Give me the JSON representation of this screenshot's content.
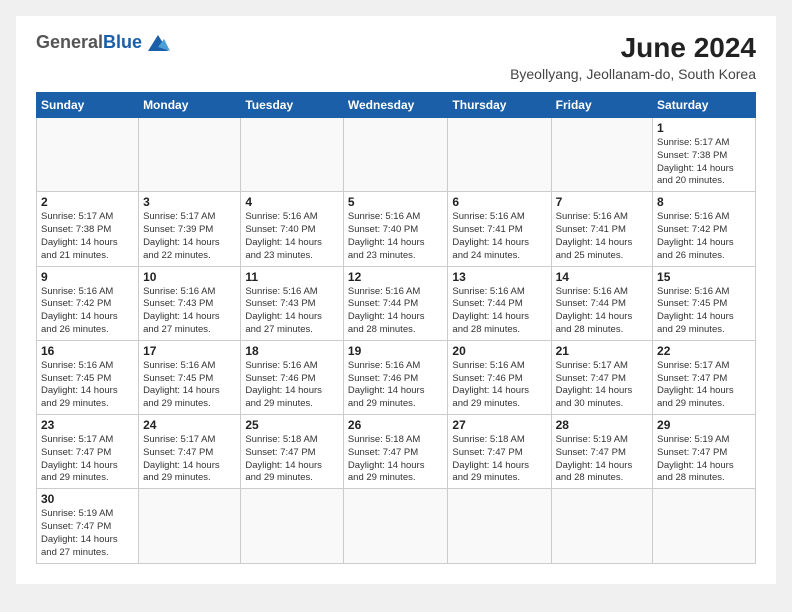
{
  "header": {
    "logo_general": "General",
    "logo_blue": "Blue",
    "month_year": "June 2024",
    "location": "Byeollyang, Jeollanam-do, South Korea"
  },
  "days_of_week": [
    "Sunday",
    "Monday",
    "Tuesday",
    "Wednesday",
    "Thursday",
    "Friday",
    "Saturday"
  ],
  "weeks": [
    [
      {
        "day": "",
        "info": ""
      },
      {
        "day": "",
        "info": ""
      },
      {
        "day": "",
        "info": ""
      },
      {
        "day": "",
        "info": ""
      },
      {
        "day": "",
        "info": ""
      },
      {
        "day": "",
        "info": ""
      },
      {
        "day": "1",
        "info": "Sunrise: 5:17 AM\nSunset: 7:38 PM\nDaylight: 14 hours\nand 20 minutes."
      }
    ],
    [
      {
        "day": "2",
        "info": "Sunrise: 5:17 AM\nSunset: 7:38 PM\nDaylight: 14 hours\nand 21 minutes."
      },
      {
        "day": "3",
        "info": "Sunrise: 5:17 AM\nSunset: 7:39 PM\nDaylight: 14 hours\nand 22 minutes."
      },
      {
        "day": "4",
        "info": "Sunrise: 5:16 AM\nSunset: 7:40 PM\nDaylight: 14 hours\nand 23 minutes."
      },
      {
        "day": "5",
        "info": "Sunrise: 5:16 AM\nSunset: 7:40 PM\nDaylight: 14 hours\nand 23 minutes."
      },
      {
        "day": "6",
        "info": "Sunrise: 5:16 AM\nSunset: 7:41 PM\nDaylight: 14 hours\nand 24 minutes."
      },
      {
        "day": "7",
        "info": "Sunrise: 5:16 AM\nSunset: 7:41 PM\nDaylight: 14 hours\nand 25 minutes."
      },
      {
        "day": "8",
        "info": "Sunrise: 5:16 AM\nSunset: 7:42 PM\nDaylight: 14 hours\nand 26 minutes."
      }
    ],
    [
      {
        "day": "9",
        "info": "Sunrise: 5:16 AM\nSunset: 7:42 PM\nDaylight: 14 hours\nand 26 minutes."
      },
      {
        "day": "10",
        "info": "Sunrise: 5:16 AM\nSunset: 7:43 PM\nDaylight: 14 hours\nand 27 minutes."
      },
      {
        "day": "11",
        "info": "Sunrise: 5:16 AM\nSunset: 7:43 PM\nDaylight: 14 hours\nand 27 minutes."
      },
      {
        "day": "12",
        "info": "Sunrise: 5:16 AM\nSunset: 7:44 PM\nDaylight: 14 hours\nand 28 minutes."
      },
      {
        "day": "13",
        "info": "Sunrise: 5:16 AM\nSunset: 7:44 PM\nDaylight: 14 hours\nand 28 minutes."
      },
      {
        "day": "14",
        "info": "Sunrise: 5:16 AM\nSunset: 7:44 PM\nDaylight: 14 hours\nand 28 minutes."
      },
      {
        "day": "15",
        "info": "Sunrise: 5:16 AM\nSunset: 7:45 PM\nDaylight: 14 hours\nand 29 minutes."
      }
    ],
    [
      {
        "day": "16",
        "info": "Sunrise: 5:16 AM\nSunset: 7:45 PM\nDaylight: 14 hours\nand 29 minutes."
      },
      {
        "day": "17",
        "info": "Sunrise: 5:16 AM\nSunset: 7:45 PM\nDaylight: 14 hours\nand 29 minutes."
      },
      {
        "day": "18",
        "info": "Sunrise: 5:16 AM\nSunset: 7:46 PM\nDaylight: 14 hours\nand 29 minutes."
      },
      {
        "day": "19",
        "info": "Sunrise: 5:16 AM\nSunset: 7:46 PM\nDaylight: 14 hours\nand 29 minutes."
      },
      {
        "day": "20",
        "info": "Sunrise: 5:16 AM\nSunset: 7:46 PM\nDaylight: 14 hours\nand 29 minutes."
      },
      {
        "day": "21",
        "info": "Sunrise: 5:17 AM\nSunset: 7:47 PM\nDaylight: 14 hours\nand 30 minutes."
      },
      {
        "day": "22",
        "info": "Sunrise: 5:17 AM\nSunset: 7:47 PM\nDaylight: 14 hours\nand 29 minutes."
      }
    ],
    [
      {
        "day": "23",
        "info": "Sunrise: 5:17 AM\nSunset: 7:47 PM\nDaylight: 14 hours\nand 29 minutes."
      },
      {
        "day": "24",
        "info": "Sunrise: 5:17 AM\nSunset: 7:47 PM\nDaylight: 14 hours\nand 29 minutes."
      },
      {
        "day": "25",
        "info": "Sunrise: 5:18 AM\nSunset: 7:47 PM\nDaylight: 14 hours\nand 29 minutes."
      },
      {
        "day": "26",
        "info": "Sunrise: 5:18 AM\nSunset: 7:47 PM\nDaylight: 14 hours\nand 29 minutes."
      },
      {
        "day": "27",
        "info": "Sunrise: 5:18 AM\nSunset: 7:47 PM\nDaylight: 14 hours\nand 29 minutes."
      },
      {
        "day": "28",
        "info": "Sunrise: 5:19 AM\nSunset: 7:47 PM\nDaylight: 14 hours\nand 28 minutes."
      },
      {
        "day": "29",
        "info": "Sunrise: 5:19 AM\nSunset: 7:47 PM\nDaylight: 14 hours\nand 28 minutes."
      }
    ],
    [
      {
        "day": "30",
        "info": "Sunrise: 5:19 AM\nSunset: 7:47 PM\nDaylight: 14 hours\nand 27 minutes."
      },
      {
        "day": "",
        "info": ""
      },
      {
        "day": "",
        "info": ""
      },
      {
        "day": "",
        "info": ""
      },
      {
        "day": "",
        "info": ""
      },
      {
        "day": "",
        "info": ""
      },
      {
        "day": "",
        "info": ""
      }
    ]
  ]
}
